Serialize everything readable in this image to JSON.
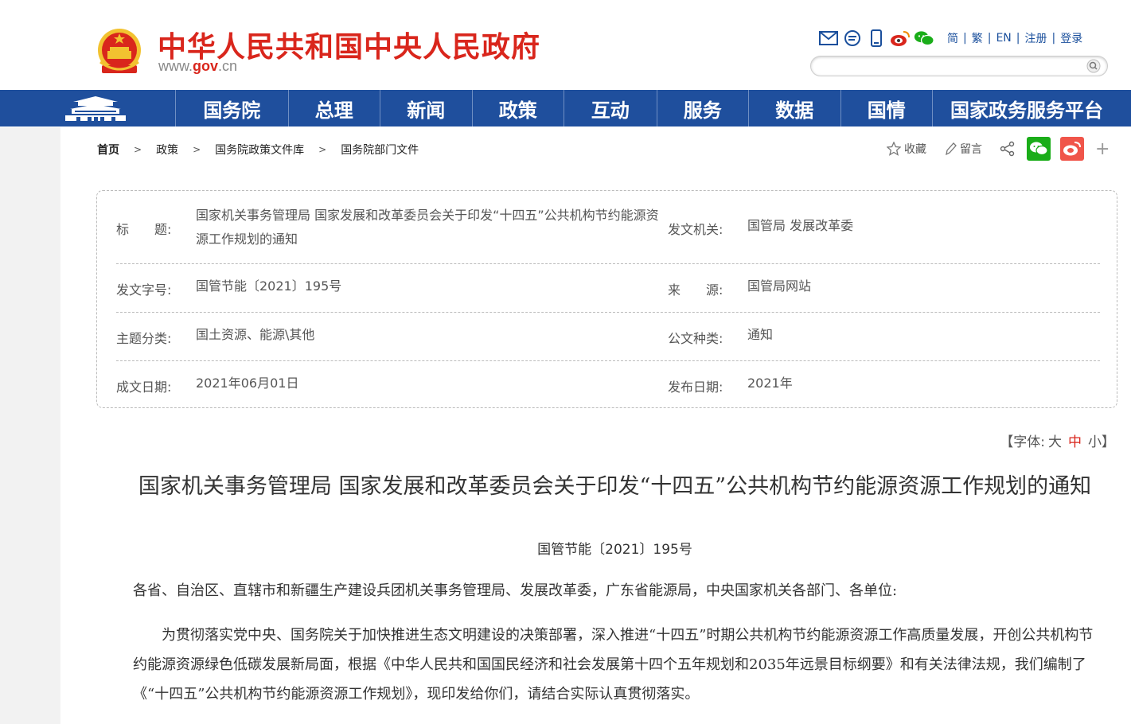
{
  "header": {
    "site_title": "中华人民共和国中央人民政府",
    "site_url_prefix": "www.",
    "site_url_domain": "gov",
    "site_url_suffix": ".cn",
    "lang_links": [
      "简",
      "繁",
      "EN",
      "注册",
      "登录"
    ],
    "search_placeholder": ""
  },
  "nav": {
    "items": [
      "国务院",
      "总理",
      "新闻",
      "政策",
      "互动",
      "服务",
      "数据",
      "国情",
      "国家政务服务平台"
    ]
  },
  "breadcrumb": [
    "首页",
    "政策",
    "国务院政策文件库",
    "国务院部门文件"
  ],
  "share": {
    "favorite": "收藏",
    "comment": "留言",
    "plus": "+"
  },
  "info": {
    "title_label": "标　　题:",
    "title_value": "国家机关事务管理局 国家发展和改革委员会关于印发“十四五”公共机构节约能源资源工作规划的通知",
    "issuer_label": "发文机关:",
    "issuer_value": "国管局 发展改革委",
    "doc_no_label": "发文字号:",
    "doc_no_value": "国管节能〔2021〕195号",
    "source_label": "来　　源:",
    "source_value": "国管局网站",
    "topic_label": "主题分类:",
    "topic_value": "国土资源、能源\\其他",
    "type_label": "公文种类:",
    "type_value": "通知",
    "written_label": "成文日期:",
    "written_value": "2021年06月01日",
    "published_label": "发布日期:",
    "published_value": "2021年"
  },
  "fontsize": {
    "open": "【字体:",
    "large": "大",
    "medium": "中",
    "small": "小",
    "close": "】"
  },
  "article": {
    "title": "国家机关事务管理局 国家发展和改革委员会关于印发“十四五”公共机构节约能源资源工作规划的通知",
    "doc_no": "国管节能〔2021〕195号",
    "salutation": "各省、自治区、直辖市和新疆生产建设兵团机关事务管理局、发展改革委，广东省能源局，中央国家机关各部门、各单位:",
    "para1": "　　为贯彻落实党中央、国务院关于加快推进生态文明建设的决策部署，深入推进“十四五”时期公共机构节约能源资源工作高质量发展，开创公共机构节约能源资源绿色低碳发展新局面，根据《中华人民共和国国民经济和社会发展第十四个五年规划和2035年远景目标纲要》和有关法律法规，我们编制了《“十四五”公共机构节约能源资源工作规划》，现印发给你们，请结合实际认真贯彻落实。"
  },
  "colors": {
    "brand_red": "#d9261c",
    "nav_blue": "#1f4f9d",
    "wechat_green": "#1aad19",
    "weibo_red": "#f0554a"
  }
}
